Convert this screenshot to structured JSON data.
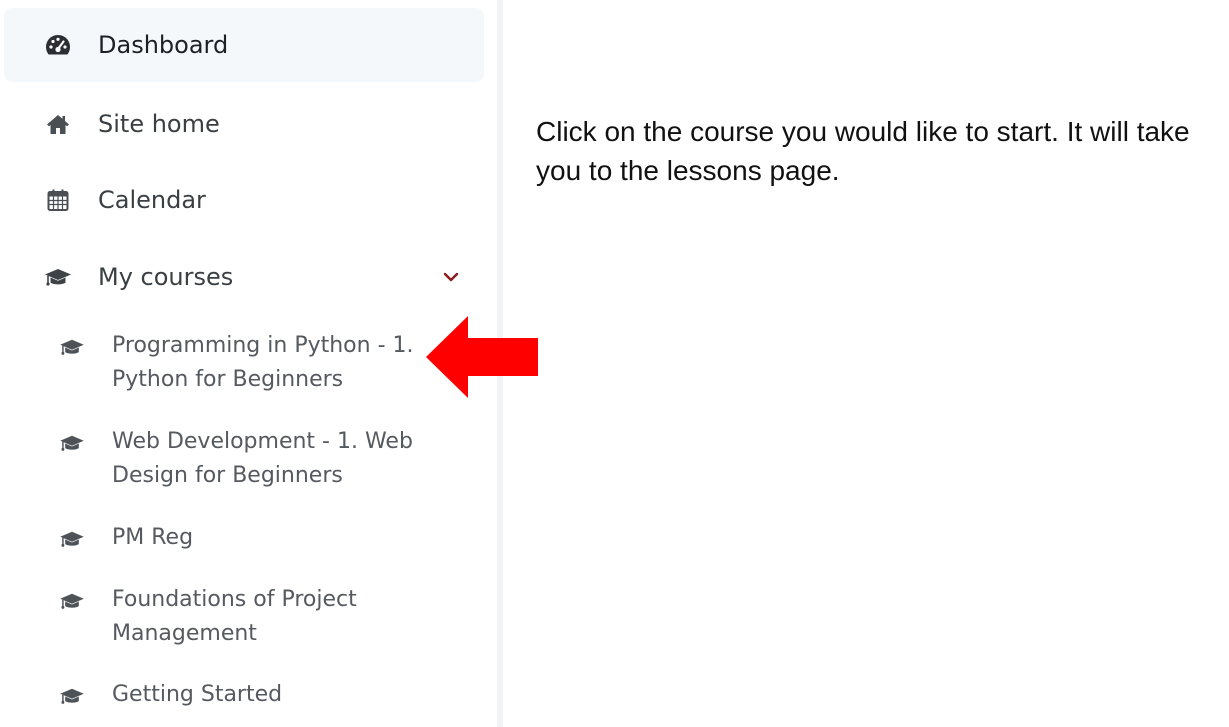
{
  "sidebar": {
    "items": [
      {
        "label": "Dashboard",
        "icon": "tachometer-icon"
      },
      {
        "label": "Site home",
        "icon": "home-icon"
      },
      {
        "label": "Calendar",
        "icon": "calendar-icon"
      },
      {
        "label": "My courses",
        "icon": "graduation-cap-icon"
      }
    ],
    "courses": [
      {
        "label": "Programming in Python - 1. Python for Beginners",
        "icon": "graduation-cap-icon"
      },
      {
        "label": "Web Development - 1. Web Design for Beginners",
        "icon": "graduation-cap-icon"
      },
      {
        "label": "PM Reg",
        "icon": "graduation-cap-icon"
      },
      {
        "label": "Foundations of Project Management",
        "icon": "graduation-cap-icon"
      },
      {
        "label": "Getting Started",
        "icon": "graduation-cap-icon"
      }
    ]
  },
  "instruction": {
    "text": "Click on the course you would like to start. It will take you to the lessons page."
  },
  "colors": {
    "accent_red": "#ff0000",
    "chevron": "#8b1a1a",
    "active_bg": "#f5f8fb"
  }
}
